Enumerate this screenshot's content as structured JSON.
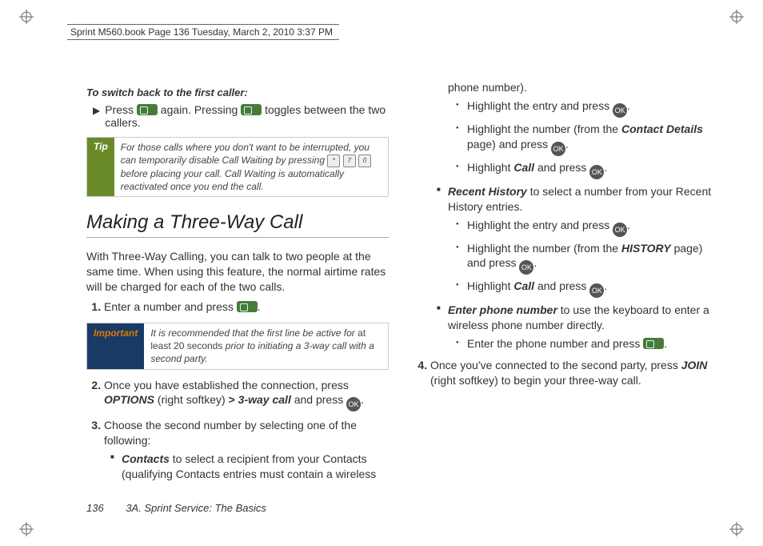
{
  "header": "Sprint M560.book  Page 136  Tuesday, March 2, 2010  3:37 PM",
  "col1": {
    "switch_back_heading": "To switch back to the first caller:",
    "press_word": "Press ",
    "again_pressing": " again. Pressing ",
    "toggles_between": " toggles between the two callers.",
    "tip_label": "Tip",
    "tip_body_1": "For those calls where you don't want to be interrupted, you can temporarily disable Call Waiting by pressing ",
    "tip_body_2": " before placing your call. Call Waiting is automatically reactivated once you end the call.",
    "section_title": "Making a Three-Way Call",
    "intro": "With Three-Way Calling, you can talk to two people at the same time. When using this feature, the normal airtime rates will be charged for each of the two calls.",
    "step1_a": "Enter a number and press ",
    "step1_b": ".",
    "important_label": "Important",
    "important_body_a": "It is recommended that the first line be active for ",
    "important_bold": "at least 20 seconds",
    "important_body_b": " prior to initiating a 3-way call with a second party.",
    "step2_a": "Once you have established the connection, press ",
    "step2_options": "OPTIONS",
    "step2_b": " (right softkey) ",
    "step2_gt": ">",
    "step2_3way": " 3-way call",
    "step2_c": " and press ",
    "step2_d": "."
  },
  "col2": {
    "step3": "Choose the second number by selecting one of the following:",
    "contacts_bi": "Contacts",
    "contacts_rest": " to select a recipient from your Contacts (qualifying Contacts entries must contain a wireless phone number).",
    "hl_entry_a": "Highlight the entry and press ",
    "dot_period": ".",
    "hl_num_a": "Highlight the number (from the ",
    "contact_details": "Contact Details",
    "hl_num_b": " page) and press ",
    "hl_call_a": "Highlight ",
    "call_word": "Call",
    "hl_call_b": " and press ",
    "recent_bi": "Recent History",
    "recent_rest": " to select a number from your Recent History entries.",
    "hl_num2_a": "Highlight the number (from the ",
    "history_word": "HISTORY",
    "hl_num2_b": " page) and press ",
    "enter_bi": "Enter phone number",
    "enter_rest": " to use the keyboard to enter a wireless phone number directly.",
    "enter_sub_a": "Enter the phone number and press ",
    "step4_a": "Once you've connected to the second party, press ",
    "join_word": "JOIN",
    "step4_b": " (right softkey) to begin your three-way call."
  },
  "footer": {
    "page": "136",
    "title": "3A. Sprint Service: The Basics"
  },
  "icons": {
    "ok": "OK"
  }
}
